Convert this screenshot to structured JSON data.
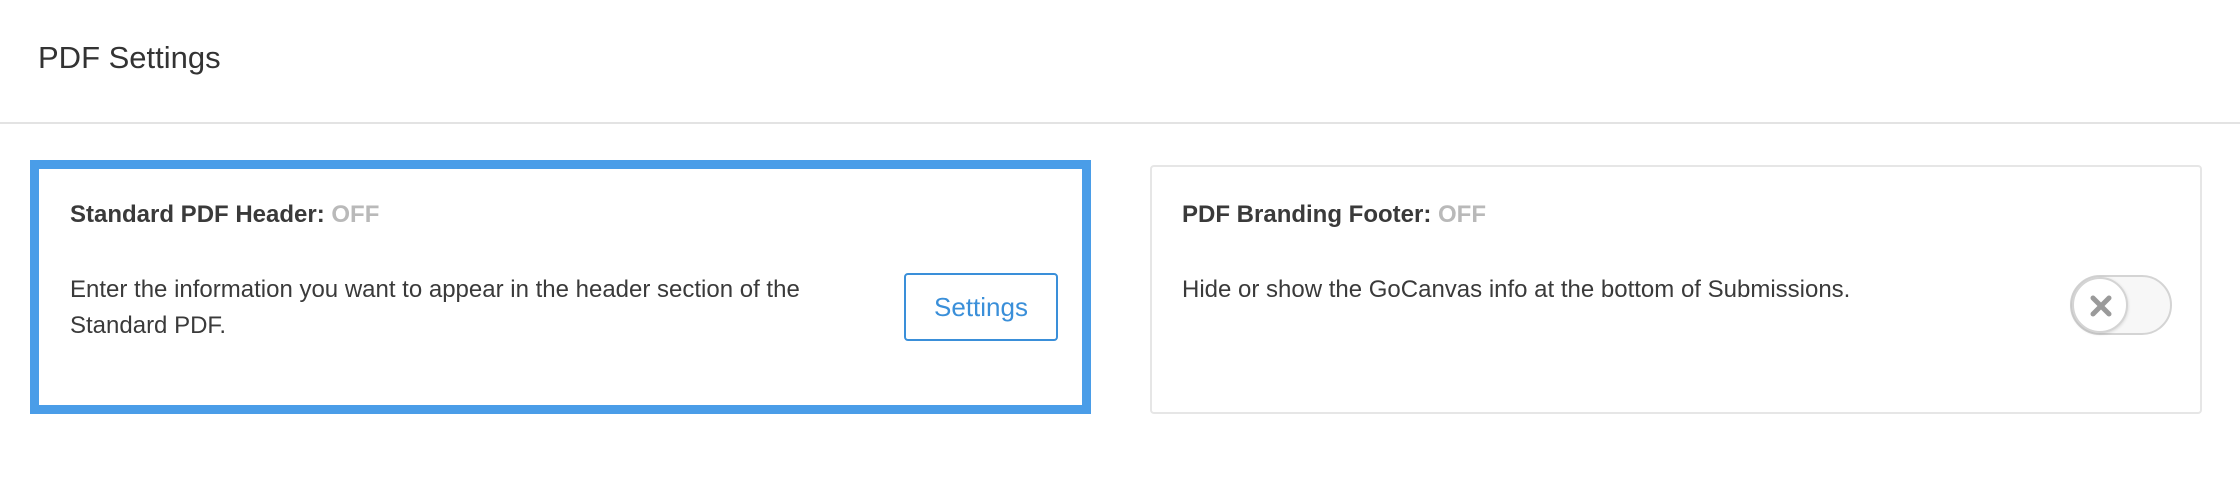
{
  "header": {
    "title": "PDF Settings"
  },
  "cards": [
    {
      "title": "Standard PDF Header:",
      "status": "OFF",
      "description": "Enter the information you want to appear in the header section of the Standard PDF.",
      "button_label": "Settings",
      "selected": true
    },
    {
      "title": "PDF Branding Footer:",
      "status": "OFF",
      "description": "Hide or show the GoCanvas info at the bottom of Submissions.",
      "toggle_on": false
    }
  ],
  "colors": {
    "selection_border": "#4a9de8",
    "accent": "#3a8fd9",
    "status_off": "#b9b9b9",
    "toggle_x": "#9a9a9a"
  },
  "icons": {
    "toggle_off": "close-icon"
  }
}
